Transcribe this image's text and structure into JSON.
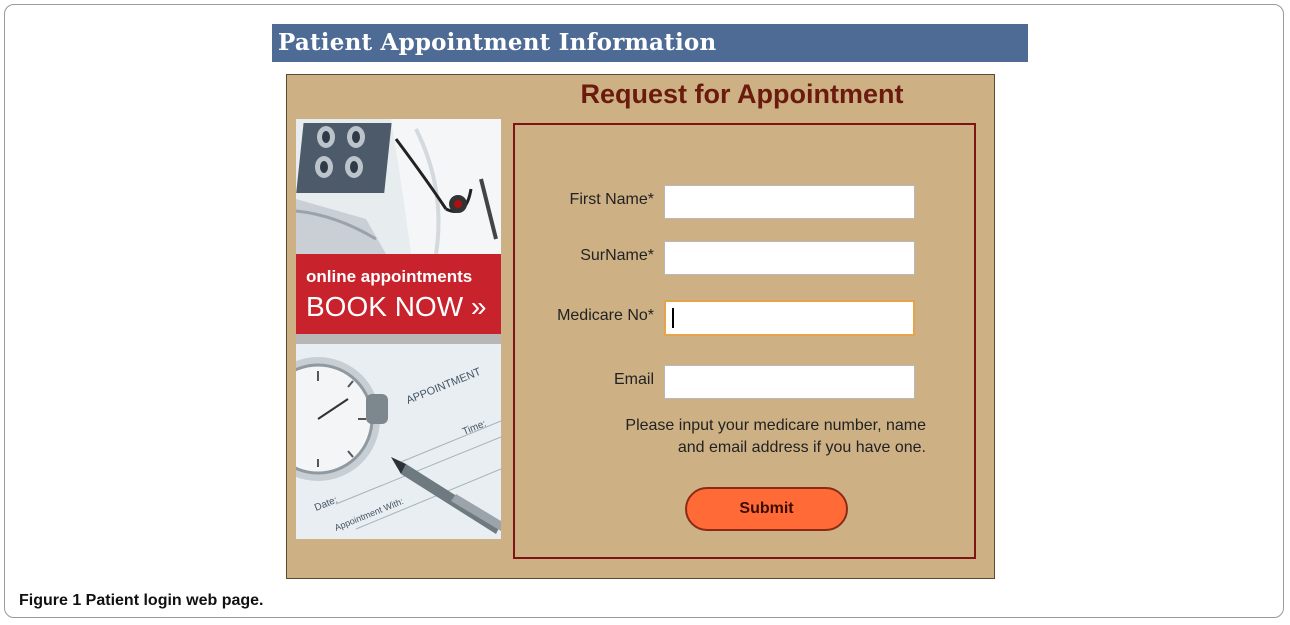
{
  "header": {
    "title": "Patient Appointment Information"
  },
  "panel": {
    "heading": "Request for Appointment"
  },
  "promo": {
    "line1": "online appointments",
    "line2": "BOOK NOW »",
    "appointment_card": {
      "title": "APPOINTMENT",
      "time_label": "Time:",
      "date_label": "Date:",
      "with_label": "Appointment With:"
    }
  },
  "form": {
    "first_name": {
      "label": "First Name*",
      "value": "",
      "placeholder": ""
    },
    "surname": {
      "label": "SurName*",
      "value": "",
      "placeholder": ""
    },
    "medicare": {
      "label": "Medicare No*",
      "value": "",
      "placeholder": ""
    },
    "email": {
      "label": "Email",
      "value": "",
      "placeholder": ""
    },
    "help_line1": "Please input your medicare number, name",
    "help_line2": "and email address if you have one.",
    "submit_label": "Submit"
  },
  "caption": {
    "label": "Figure 1",
    "text": " Patient login web page."
  },
  "colors": {
    "title_bar": "#4e6b96",
    "panel_bg": "#cdb185",
    "heading": "#6b1a0e",
    "form_border": "#7e1414",
    "submit_bg": "#ff6a36",
    "promo_banner": "#c8232c"
  }
}
